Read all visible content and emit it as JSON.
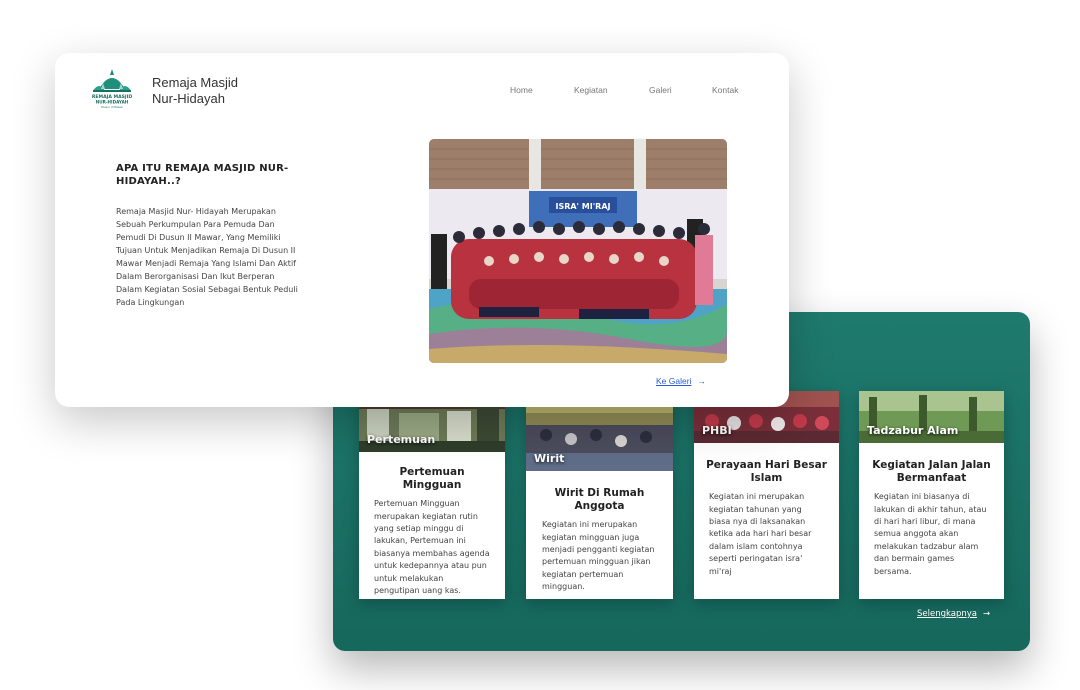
{
  "header": {
    "brand_line1": "Remaja Masjid",
    "brand_line2": "Nur-Hidayah",
    "logo_text_line1": "REMAJA MASJID",
    "logo_text_line2": "NUR-HIDAYAH",
    "logo_text_line3": "Dusun II Mawar",
    "nav": [
      "Home",
      "Kegiatan",
      "Galeri",
      "Kontak"
    ]
  },
  "about": {
    "title": "APA ITU REMAJA MASJID NUR-HIDAYAH..?",
    "description": "Remaja Masjid Nur- Hidayah Merupakan Sebuah Perkumpulan Para Pemuda Dan Pemudi Di Dusun II Mawar, Yang Memiliki Tujuan Untuk Menjadikan Remaja Di Dusun II Mawar Menjadi Remaja Yang Islami Dan Aktif Dalam Berorganisasi Dan Ikut Berperan Dalam Kegiatan Sosial Sebagai Bentuk Peduli Pada Lingkungan",
    "photo_banner_text": "ISRA' MI'RAJ",
    "gallery_link": "Ke Galeri",
    "arrow": "→"
  },
  "activities": {
    "cards": [
      {
        "image_label": "Pertemuan",
        "title": "Pertemuan Mingguan",
        "description": "Pertemuan Mingguan merupakan kegiatan rutin yang setiap minggu di lakukan, Pertemuan ini biasanya membahas agenda untuk kedepannya atau pun untuk melakukan pengutipan uang kas."
      },
      {
        "image_label": "Wirit",
        "title": "Wirit Di Rumah Anggota",
        "description": "Kegiatan ini merupakan kegiatan mingguan juga menjadi pengganti kegiatan pertemuan mingguan jikan kegiatan pertemuan mingguan."
      },
      {
        "image_label": "PHBI",
        "title": "Perayaan Hari Besar Islam",
        "description": "Kegiatan ini merupakan kegiatan tahunan yang biasa nya di laksanakan ketika ada hari hari besar dalam islam contohnya seperti peringatan isra' mi'raj"
      },
      {
        "image_label": "Tadzabur Alam",
        "title": "Kegiatan Jalan Jalan Bermanfaat",
        "description": "Kegiatan ini biasanya di lakukan di akhir tahun, atau di hari hari libur, di mana semua anggota akan melakukan tadzabur alam dan bermain games bersama."
      }
    ],
    "more_link": "Selengkapnya",
    "arrow": "→"
  },
  "colors": {
    "teal": "#1a6f64",
    "link_blue": "#2a5bd7"
  }
}
